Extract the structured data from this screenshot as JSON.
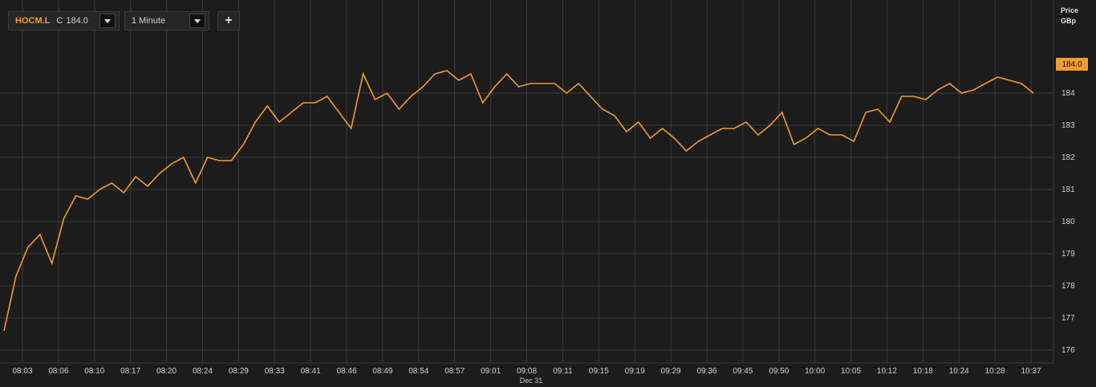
{
  "toolbar": {
    "symbol": "HOCM.L",
    "close_prefix": "C",
    "close_value": "184.0",
    "interval": "1 Minute",
    "add_label": "+"
  },
  "axis": {
    "header_line1": "Price",
    "header_line2": "GBp",
    "last_value_label": "184.0",
    "date_label": "Dec 31"
  },
  "colors": {
    "background": "#1c1c1c",
    "grid": "#3a3a3a",
    "line": "#f39a2e",
    "text": "#cfcfcf"
  },
  "chart_data": {
    "type": "line",
    "ylim": [
      175.6,
      186.9
    ],
    "yticks": [
      176,
      177,
      178,
      179,
      180,
      181,
      182,
      183,
      184
    ],
    "xticks": [
      "08:03",
      "08:06",
      "08:10",
      "08:17",
      "08:20",
      "08:24",
      "08:29",
      "08:33",
      "08:41",
      "08:46",
      "08:49",
      "08:54",
      "08:57",
      "09:01",
      "09:08",
      "09:11",
      "09:15",
      "09:19",
      "09:29",
      "09:36",
      "09:45",
      "09:50",
      "10:00",
      "10:05",
      "10:12",
      "10:18",
      "10:24",
      "10:28",
      "10:37"
    ],
    "grid": true,
    "series": [
      {
        "values": [
          176.6,
          178.3,
          179.2,
          179.6,
          178.7,
          180.1,
          180.8,
          180.7,
          181.0,
          181.2,
          180.9,
          181.4,
          181.1,
          181.5,
          181.8,
          182.0,
          181.2,
          182.0,
          181.9,
          181.9,
          182.4,
          183.1,
          183.6,
          183.1,
          183.4,
          183.7,
          183.7,
          183.9,
          183.4,
          182.9,
          184.6,
          183.8,
          184.0,
          183.5,
          183.9,
          184.2,
          184.6,
          184.7,
          184.4,
          184.6,
          183.7,
          184.2,
          184.6,
          184.2,
          184.3,
          184.3,
          184.3,
          184.0,
          184.3,
          183.9,
          183.5,
          183.3,
          182.8,
          183.1,
          182.6,
          182.9,
          182.6,
          182.2,
          182.5,
          182.7,
          182.9,
          182.9,
          183.1,
          182.7,
          183.0,
          183.4,
          182.4,
          182.6,
          182.9,
          182.7,
          182.7,
          182.5,
          183.4,
          183.5,
          183.1,
          183.9,
          183.9,
          183.8,
          184.1,
          184.3,
          184.0,
          184.1,
          184.3,
          184.5,
          184.4,
          184.3,
          184.0
        ]
      }
    ]
  }
}
